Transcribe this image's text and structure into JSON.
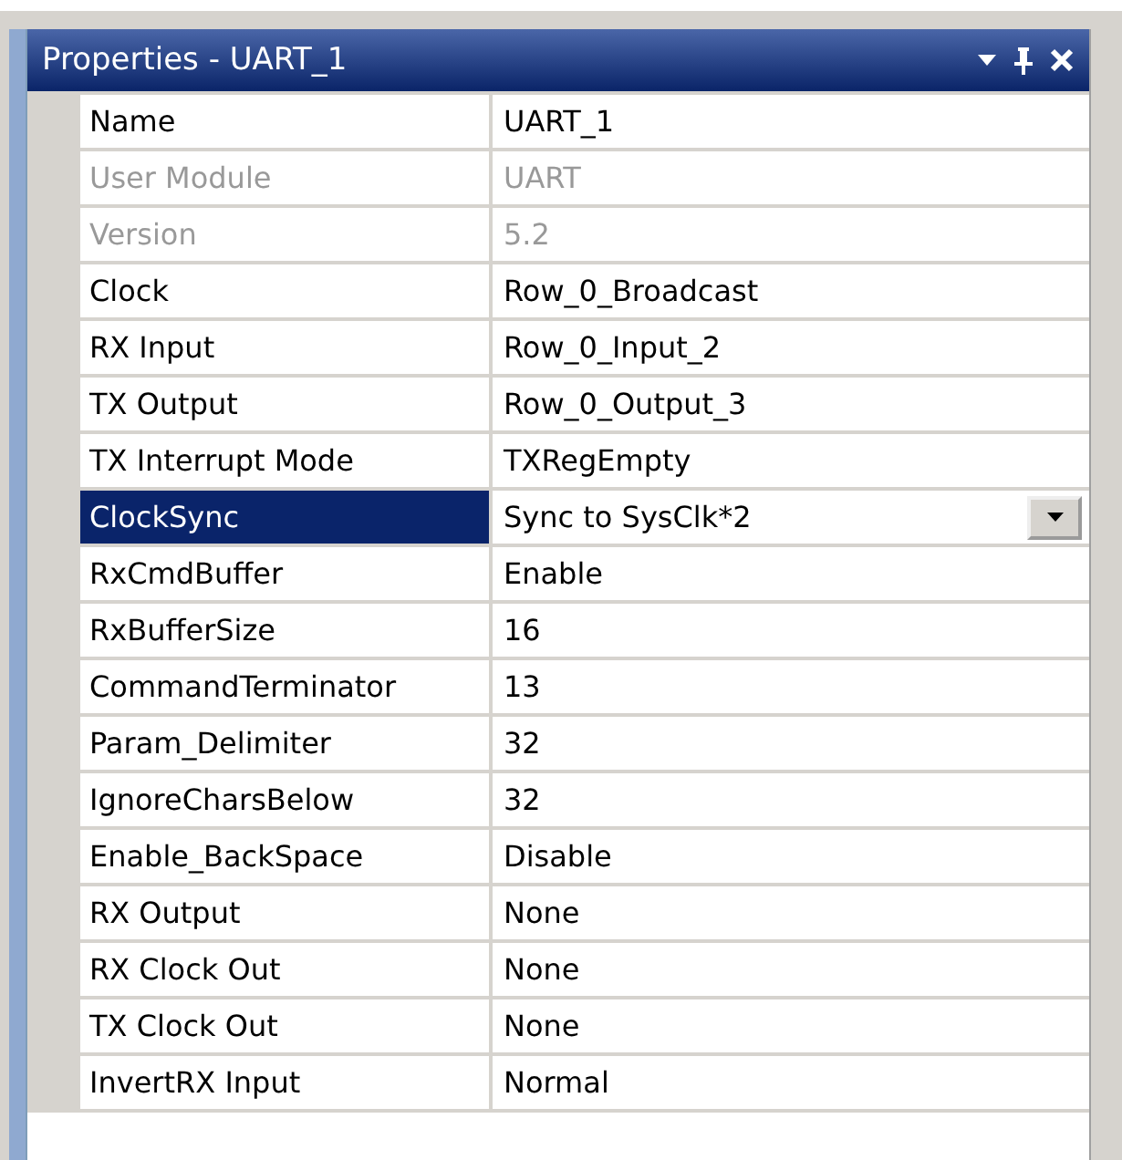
{
  "window": {
    "title": "Properties - UART_1"
  },
  "properties": [
    {
      "name": "Name",
      "value": "UART_1",
      "disabled": false,
      "selected": false
    },
    {
      "name": "User Module",
      "value": "UART",
      "disabled": true,
      "selected": false
    },
    {
      "name": "Version",
      "value": "5.2",
      "disabled": true,
      "selected": false
    },
    {
      "name": "Clock",
      "value": "Row_0_Broadcast",
      "disabled": false,
      "selected": false
    },
    {
      "name": "RX Input",
      "value": "Row_0_Input_2",
      "disabled": false,
      "selected": false
    },
    {
      "name": "TX Output",
      "value": "Row_0_Output_3",
      "disabled": false,
      "selected": false
    },
    {
      "name": "TX Interrupt Mode",
      "value": "TXRegEmpty",
      "disabled": false,
      "selected": false
    },
    {
      "name": "ClockSync",
      "value": "Sync to SysClk*2",
      "disabled": false,
      "selected": true
    },
    {
      "name": "RxCmdBuffer",
      "value": "Enable",
      "disabled": false,
      "selected": false
    },
    {
      "name": "RxBufferSize",
      "value": "16",
      "disabled": false,
      "selected": false
    },
    {
      "name": "CommandTerminator",
      "value": "13",
      "disabled": false,
      "selected": false
    },
    {
      "name": "Param_Delimiter",
      "value": "32",
      "disabled": false,
      "selected": false
    },
    {
      "name": "IgnoreCharsBelow",
      "value": "32",
      "disabled": false,
      "selected": false
    },
    {
      "name": "Enable_BackSpace",
      "value": "Disable",
      "disabled": false,
      "selected": false
    },
    {
      "name": "RX Output",
      "value": "None",
      "disabled": false,
      "selected": false
    },
    {
      "name": "RX Clock Out",
      "value": "None",
      "disabled": false,
      "selected": false
    },
    {
      "name": "TX Clock Out",
      "value": "None",
      "disabled": false,
      "selected": false
    },
    {
      "name": "InvertRX Input",
      "value": "Normal",
      "disabled": false,
      "selected": false
    }
  ]
}
